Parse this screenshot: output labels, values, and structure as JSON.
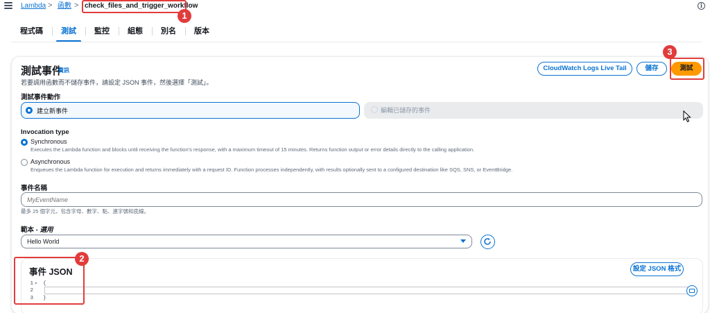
{
  "breadcrumb": {
    "items": [
      "Lambda",
      "函數",
      "check_files_and_trigger_workflow"
    ],
    "separator": ">"
  },
  "tabs": [
    "程式碼",
    "測試",
    "監控",
    "組態",
    "別名",
    "版本"
  ],
  "active_tab": "測試",
  "test_event": {
    "title": "測試事件",
    "info_link": "資訊",
    "description": "若要調用函數而不儲存事件，請設定 JSON 事件，然後選擇「測試」。",
    "buttons": {
      "live_tail": "CloudWatch Logs Live Tail",
      "save": "儲存",
      "test": "測試"
    },
    "action_label": "測試事件動作",
    "action_new": "建立新事件",
    "action_edit": "編輯已儲存的事件"
  },
  "invocation": {
    "label": "Invocation type",
    "sync_title": "Synchronous",
    "sync_desc": "Executes the Lambda function and blocks until receiving the function's response, with a maximum timeout of 15 minutes. Returns function output or error details directly to the calling application.",
    "async_title": "Asynchronous",
    "async_desc": "Enqueues the Lambda function for execution and returns immediately with a request ID. Function processes independently, with results optionally sent to a configured destination like SQS, SNS, or EventBridge."
  },
  "event_name": {
    "label": "事件名稱",
    "placeholder": "MyEventName",
    "hint": "最多 25 個字元，包含字母、數字、點、連字號和底線。"
  },
  "template": {
    "label": "範本",
    "optional": "選用",
    "label_sep": " - ",
    "selected": "Hello World"
  },
  "event_json": {
    "title": "事件 JSON",
    "format_button": "設定 JSON 格式",
    "lines": [
      {
        "num": "1",
        "fold": "▾",
        "code": "{"
      },
      {
        "num": "2",
        "fold": "",
        "code": ""
      },
      {
        "num": "3",
        "fold": "",
        "code": "}"
      }
    ]
  },
  "annotations": [
    "1",
    "2",
    "3"
  ],
  "colors": {
    "accent": "#0972d3",
    "primary_button": "#ff9900",
    "annotation": "#e23b3b"
  },
  "icons": [
    "menu-icon",
    "info-icon",
    "refresh-icon",
    "caret-down-icon",
    "keyboard-icon",
    "mouse-pointer-icon"
  ]
}
